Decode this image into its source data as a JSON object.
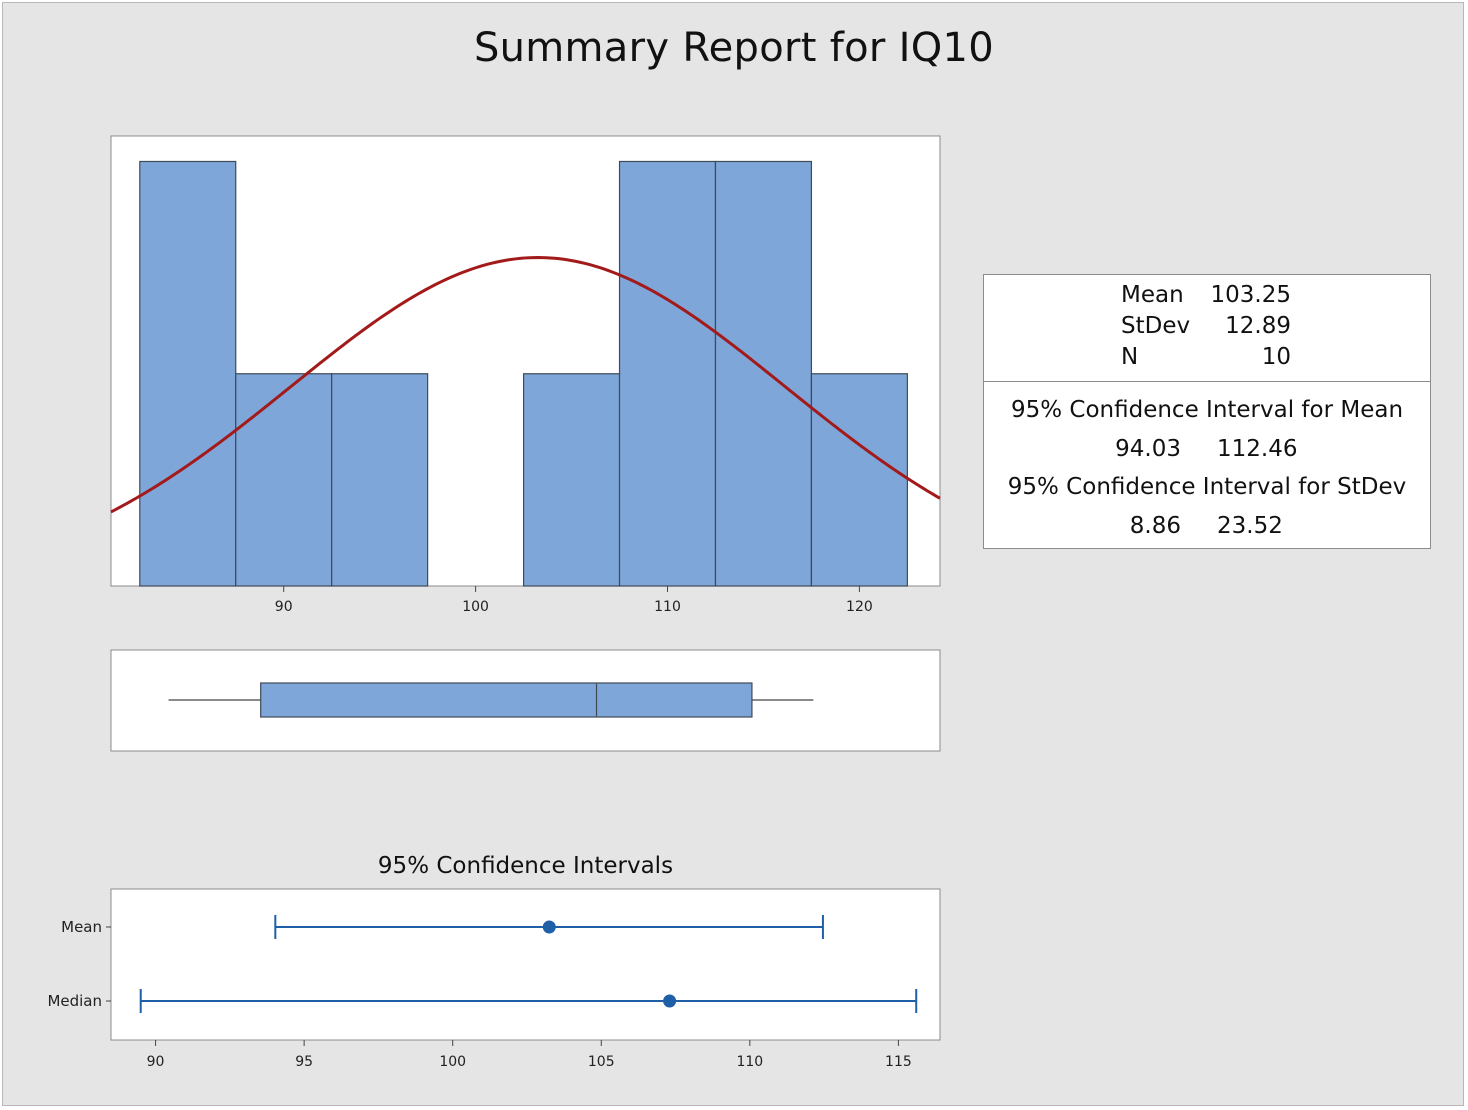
{
  "report": {
    "title": "Summary Report for IQ10"
  },
  "stats": {
    "mean_label": "Mean",
    "mean_value": "103.25",
    "stdev_label": "StDev",
    "stdev_value": "12.89",
    "n_label": "N",
    "n_value": "10",
    "ci_mean_heading": "95% Confidence Interval for Mean",
    "ci_mean_low": "94.03",
    "ci_mean_high": "112.46",
    "ci_stdev_heading": "95% Confidence Interval for StDev",
    "ci_stdev_low": "8.86",
    "ci_stdev_high": "23.52"
  },
  "colors": {
    "bar_fill": "#7ea6d9",
    "bar_stroke": "#3f4a57",
    "curve": "#a31a1a",
    "interval": "#1f5fa8",
    "panel_bg": "#ffffff",
    "page_bg": "#e5e5e5"
  },
  "chart_data": [
    {
      "type": "bar",
      "title": "",
      "subtitle": "histogram with fitted normal curve",
      "bin_width": 5,
      "bins": [
        {
          "from": 82.5,
          "to": 87.5,
          "count": 2
        },
        {
          "from": 87.5,
          "to": 92.5,
          "count": 1
        },
        {
          "from": 92.5,
          "to": 97.5,
          "count": 1
        },
        {
          "from": 97.5,
          "to": 102.5,
          "count": 0
        },
        {
          "from": 102.5,
          "to": 107.5,
          "count": 1
        },
        {
          "from": 107.5,
          "to": 112.5,
          "count": 2
        },
        {
          "from": 112.5,
          "to": 117.5,
          "count": 2
        },
        {
          "from": 117.5,
          "to": 122.5,
          "count": 1
        }
      ],
      "normal_fit": {
        "mean": 103.25,
        "stdev": 12.89
      },
      "xlim": [
        81,
        124.2
      ],
      "ylim": [
        0,
        2.12
      ],
      "xticks": [
        90,
        100,
        110,
        120
      ],
      "yaxis_labels_shown": false,
      "grid": false
    },
    {
      "type": "box",
      "title": "",
      "whisker_low": 84,
      "q1": 88.8,
      "median": 106.3,
      "q3": 114.4,
      "whisker_high": 117.6,
      "xlim": [
        81,
        124.2
      ],
      "xticks_shown": false
    },
    {
      "type": "scatter",
      "title": "95% Confidence Intervals",
      "categories": [
        "Mean",
        "Median"
      ],
      "intervals": [
        {
          "name": "Mean",
          "estimate": 103.25,
          "low": 94.03,
          "high": 112.46
        },
        {
          "name": "Median",
          "estimate": 107.3,
          "low": 89.5,
          "high": 115.6
        }
      ],
      "xlim": [
        88.5,
        116.4
      ],
      "xticks": [
        90,
        95,
        100,
        105,
        110,
        115
      ],
      "grid": false
    }
  ]
}
